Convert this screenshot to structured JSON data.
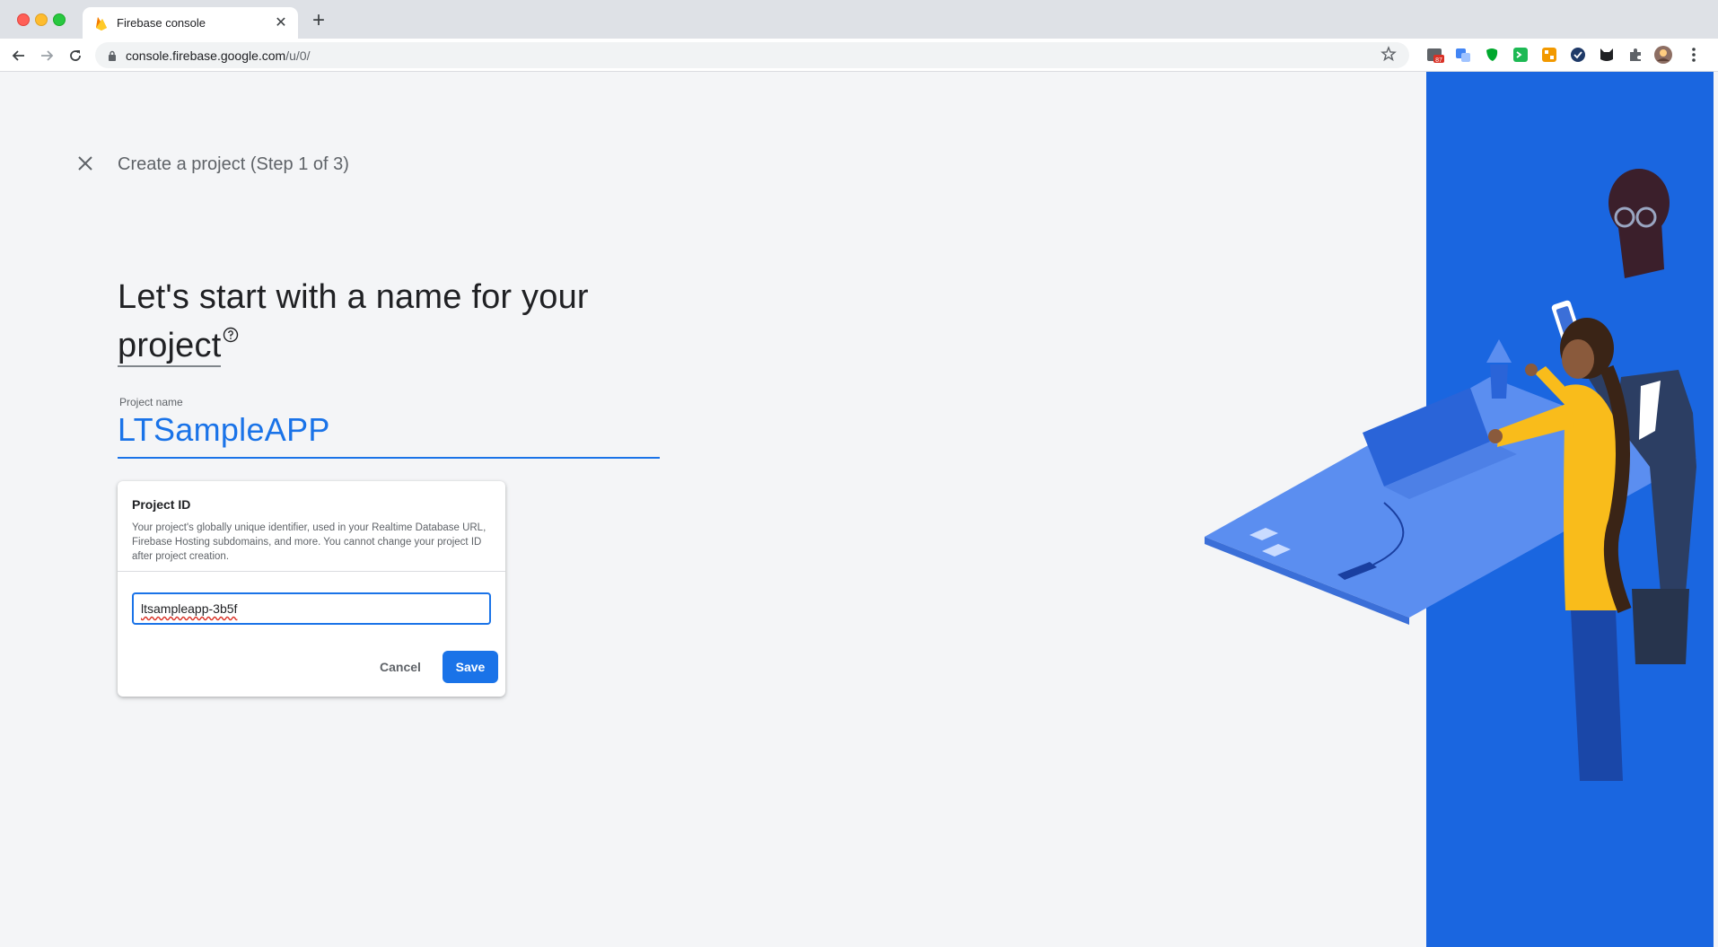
{
  "browser": {
    "tab_title": "Firebase console",
    "url_host": "console.firebase.google.com",
    "url_path": "/u/0/",
    "extension_badge": "87"
  },
  "page": {
    "step_title": "Create a project (Step 1 of 3)",
    "headline_part1": "Let's start with a name for your ",
    "headline_link": "project",
    "project_name_label": "Project name",
    "project_name_value": "LTSampleAPP"
  },
  "project_id_card": {
    "title": "Project ID",
    "description": "Your project's globally unique identifier, used in your Realtime Database URL, Firebase Hosting subdomains, and more. You cannot change your project ID after project creation.",
    "input_value": "ltsampleapp-3b5f",
    "cancel_label": "Cancel",
    "save_label": "Save"
  },
  "icons": {
    "close": "close-icon",
    "help": "help-circle-icon",
    "back": "arrow-back-icon",
    "forward": "arrow-forward-icon",
    "reload": "reload-icon",
    "lock": "lock-icon",
    "star": "star-icon",
    "menu": "more-vert-icon"
  },
  "colors": {
    "accent": "#1a73e8",
    "illustration_bg": "#1a66e0",
    "page_bg": "#f4f5f7"
  }
}
